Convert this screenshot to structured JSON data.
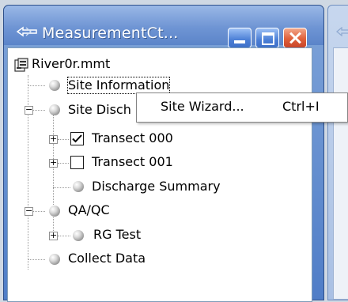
{
  "window": {
    "title": "MeasurementCt...",
    "buttons": {
      "minimize": "minimize",
      "maximize": "maximize",
      "close": "close"
    }
  },
  "tree": {
    "root": {
      "label": "River0r.mmt",
      "icon": "measurement-file-icon"
    },
    "items": [
      {
        "label": "Site Information",
        "icon": "sphere-icon"
      },
      {
        "label": "Site Disch",
        "icon": "sphere-icon",
        "expanded": true
      },
      {
        "label": "Transect 000",
        "checked": true
      },
      {
        "label": "Transect 001",
        "checked": false
      },
      {
        "label": "Discharge Summary",
        "icon": "sphere-icon"
      },
      {
        "label": "QA/QC",
        "icon": "sphere-icon",
        "expanded": true
      },
      {
        "label": "RG Test",
        "icon": "sphere-icon"
      },
      {
        "label": "Collect Data",
        "icon": "sphere-icon"
      }
    ]
  },
  "context_menu": {
    "items": [
      {
        "label": "Site Wizard...",
        "shortcut": "Ctrl+I"
      }
    ]
  },
  "colors": {
    "titlebar": "#6f95d4",
    "close_button": "#e0603a",
    "menu_border": "#848484"
  }
}
